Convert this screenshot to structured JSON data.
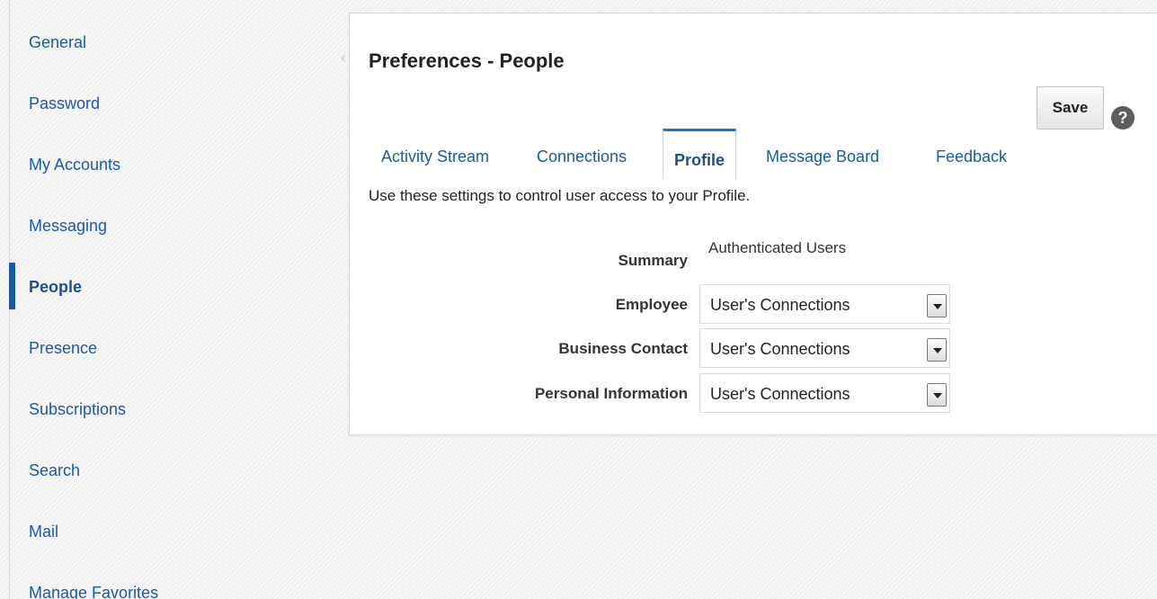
{
  "sidebar": {
    "items": [
      {
        "label": "General"
      },
      {
        "label": "Password"
      },
      {
        "label": "My Accounts"
      },
      {
        "label": "Messaging"
      },
      {
        "label": "People",
        "selected": true
      },
      {
        "label": "Presence"
      },
      {
        "label": "Subscriptions"
      },
      {
        "label": "Search"
      },
      {
        "label": "Mail"
      },
      {
        "label": "Manage Favorites"
      }
    ]
  },
  "panel": {
    "title": "Preferences - People",
    "save_label": "Save",
    "help_icon": "?",
    "tabs": [
      {
        "label": "Activity Stream"
      },
      {
        "label": "Connections"
      },
      {
        "label": "Profile",
        "active": true
      },
      {
        "label": "Message Board"
      },
      {
        "label": "Feedback"
      }
    ],
    "description": "Use these settings to control user access to your Profile.",
    "form": {
      "summary_label": "Summary",
      "summary_value": "Authenticated Users",
      "rows": [
        {
          "label": "Employee",
          "value": "User's Connections"
        },
        {
          "label": "Business Contact",
          "value": "User's Connections"
        },
        {
          "label": "Personal Information",
          "value": "User's Connections"
        }
      ]
    }
  },
  "colors": {
    "accent": "#1b5aa0",
    "active_tab_border": "#1b78c8"
  }
}
